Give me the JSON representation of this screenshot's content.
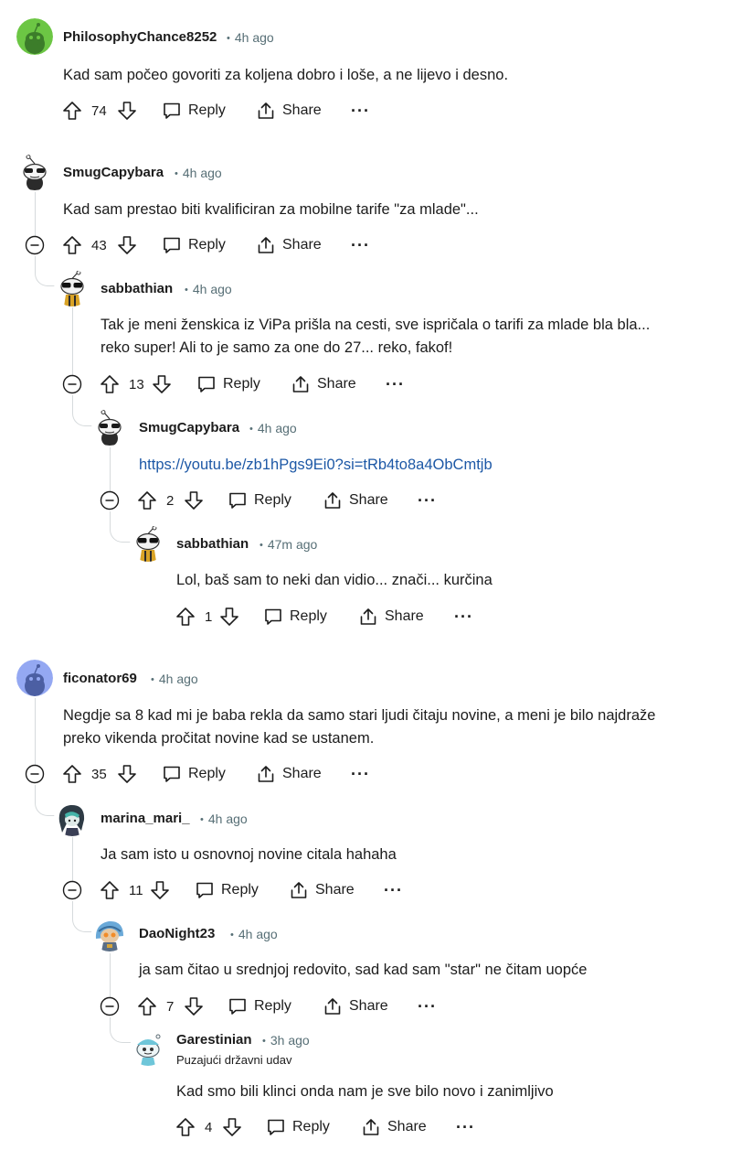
{
  "comments": [
    {
      "author": "PhilosophyChance8252",
      "time": "4h ago",
      "avatar": "green-snoo-avatar",
      "lines": [
        "Kad sam počeo govoriti za koljena dobro i loše, a ne lijevo i desno."
      ],
      "score": "74",
      "reply": "Reply",
      "share": "Share"
    },
    {
      "author": "SmugCapybara",
      "time": "4h ago",
      "avatar": "snoo-sunglasses-avatar",
      "lines": [
        "Kad sam prestao biti kvalificiran za mobilne tarife \"za mlade\"..."
      ],
      "score": "43",
      "reply": "Reply",
      "share": "Share"
    },
    {
      "author": "sabbathian",
      "time": "4h ago",
      "avatar": "snoo-shades-avatar",
      "lines": [
        "Tak je meni ženskica iz ViPa prišla na cesti, sve ispričala o tarifi za mlade bla bla...",
        "reko super! Ali to je samo za one do 27... reko, fakof!"
      ],
      "score": "13",
      "reply": "Reply",
      "share": "Share"
    },
    {
      "author": "SmugCapybara",
      "time": "4h ago",
      "avatar": "snoo-sunglasses-avatar",
      "link": "https://youtu.be/zb1hPgs9Ei0?si=tRb4to8a4ObCmtjb",
      "score": "2",
      "reply": "Reply",
      "share": "Share"
    },
    {
      "author": "sabbathian",
      "time": "47m ago",
      "avatar": "snoo-shades-avatar",
      "lines": [
        "Lol, baš sam to neki dan vidio... znači... kurčina"
      ],
      "score": "1",
      "reply": "Reply",
      "share": "Share"
    },
    {
      "author": "ficonator69",
      "time": "4h ago",
      "avatar": "blue-snoo-avatar",
      "lines": [
        "Negdje sa 8 kad mi je baba rekla da samo stari ljudi čitaju novine, a meni je bilo najdraže",
        "preko vikenda pročitat novine kad se ustanem."
      ],
      "score": "35",
      "reply": "Reply",
      "share": "Share"
    },
    {
      "author": "marina_mari_",
      "time": "4h ago",
      "avatar": "teal-hair-avatar",
      "lines": [
        "Ja sam isto u osnovnoj novine citala hahaha"
      ],
      "score": "11",
      "reply": "Reply",
      "share": "Share"
    },
    {
      "author": "DaoNight23",
      "time": "4h ago",
      "avatar": "robot-avatar",
      "lines": [
        "ja sam čitao u srednjoj redovito, sad kad sam \"star\" ne čitam uopće"
      ],
      "score": "7",
      "reply": "Reply",
      "share": "Share"
    },
    {
      "author": "Garestinian",
      "time": "3h ago",
      "flair": "Puzajući državni udav",
      "avatar": "snoo-cap-avatar",
      "lines": [
        "Kad smo bili klinci onda nam je sve bilo novo i zanimljivo"
      ],
      "score": "4",
      "reply": "Reply",
      "share": "Share"
    }
  ],
  "colors": {
    "text": "#1c1c1c",
    "meta": "#576f76",
    "link": "#1d58a6",
    "thread": "#d6dadc"
  }
}
